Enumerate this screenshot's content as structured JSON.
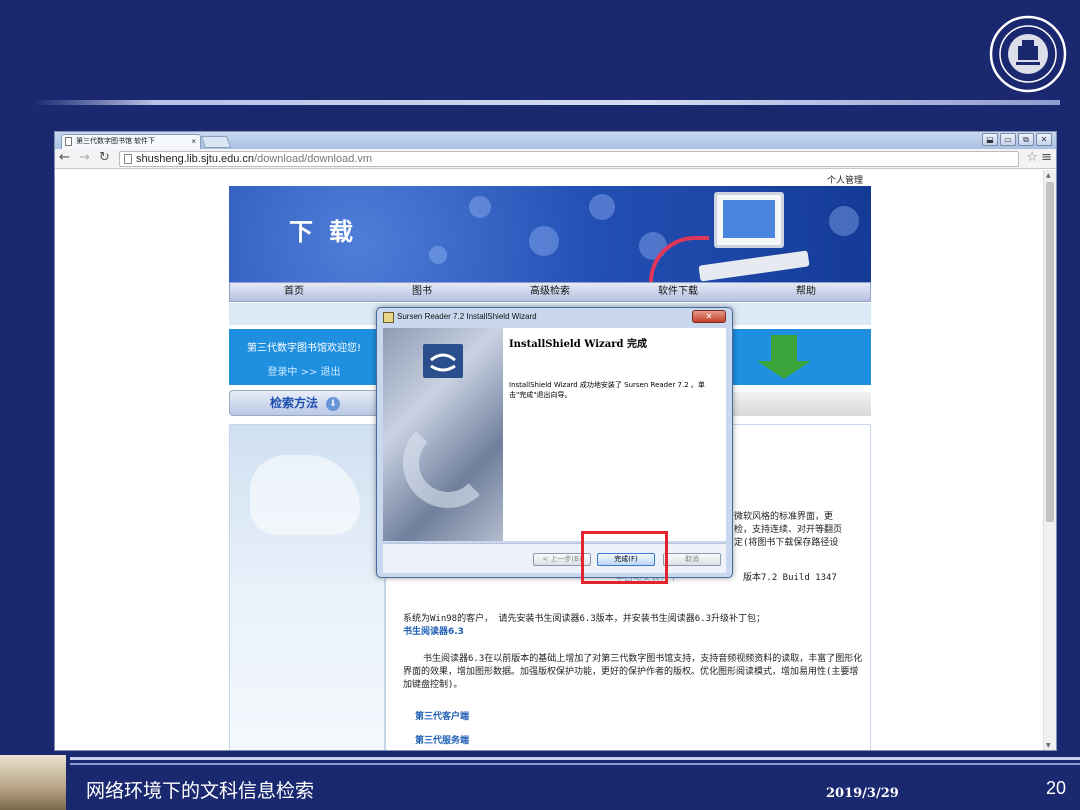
{
  "slide": {
    "footer_title": "网络环境下的文科信息检索",
    "footer_date": "2019/3/29",
    "page_number": "20"
  },
  "browser": {
    "tab_title": "第三代数字图书馆 软件下",
    "tab_close": "×",
    "url_host": "shusheng.lib.sjtu.edu.cn",
    "url_path": "/download/download.vm",
    "window_buttons": [
      "⬓",
      "▭",
      "⧉",
      "✕"
    ]
  },
  "site": {
    "personal_link": "个人管理",
    "banner_title": "下载",
    "nav": [
      "首页",
      "图书",
      "高级检索",
      "软件下载",
      "帮助"
    ],
    "welcome": "第三代数字图书馆欢迎您!",
    "login_status": "登录中 >> 退出",
    "search_method": "检索方法",
    "frag1": "微软风格的标准界面，更",
    "frag2": "检，支持连续、对开等翻页",
    "frag3": "定(将图书下载保存路径设",
    "frag4": "版本7.2 Build 1347",
    "frag_under": "本自动安装，不",
    "win98": "系统为Win98的客户， 请先安装书生阅读器6.3版本，并安装书生阅读器6.3升级补丁包；",
    "reader63": "书生阅读器6.3",
    "para": "书生阅读器6.3在以前版本的基础上增加了对第三代数字图书馆支持，支持音频视频资料的读取，丰富了图形化界面的效果，增加图形数据。加强版权保护功能，更好的保护作者的版权。优化图形阅读模式，增加易用性(主要增加键盘控制)。",
    "client": "第三代客户端",
    "server": "第三代服务端"
  },
  "dialog": {
    "title": "Sursen Reader 7.2 InstallShield Wizard",
    "close": "✕",
    "heading": "InstallShield Wizard 完成",
    "message": "InstallShield Wizard 成功地安装了 Sursen Reader 7.2 。单击\"完成\"退出向导。",
    "back_button": "< 上一步(B)",
    "finish_button": "完成(F)",
    "cancel_button": "取消"
  },
  "colors": {
    "slide_bg": "#1a2870",
    "highlight": "#e3232d",
    "site_blue": "#1f8fe0"
  }
}
